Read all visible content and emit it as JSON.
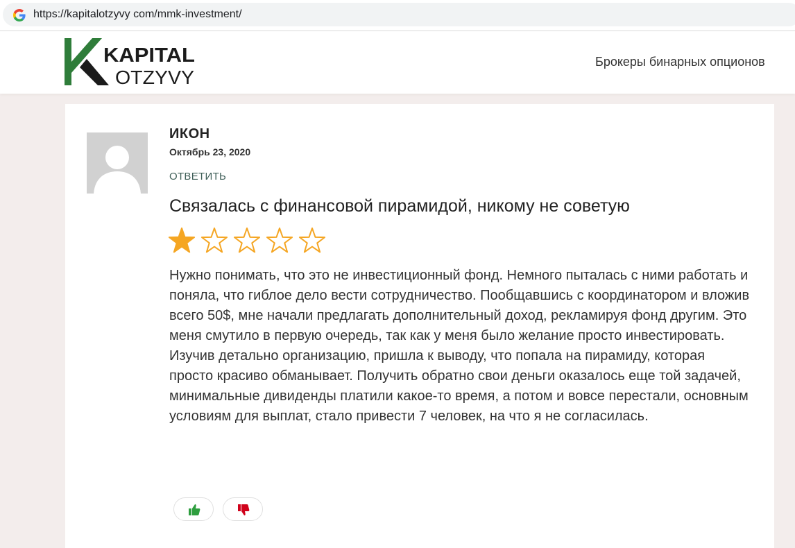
{
  "browser": {
    "url": "https://kapitalotzyvy com/mmk-investment/",
    "favicon": "google-g-icon"
  },
  "header": {
    "logo_line1": "KAPITAL",
    "logo_line2": "OTZYVY",
    "nav_item": "Брокеры бинарных опционов"
  },
  "review": {
    "author": "ИКОН",
    "date": "Октябрь 23, 2020",
    "reply_label": "ОТВЕТИТЬ",
    "title": "Связалась с финансовой пирамидой, никому не советую",
    "rating": 1,
    "rating_max": 5,
    "star_color": "#f5a623",
    "text": "Нужно понимать, что это не инвестиционный фонд. Немного пыталась с ними работать и поняла, что гиблое дело вести сотрудничество. Пообщавшись с координатором и вложив всего 50$, мне начали предлагать дополнительный доход, рекламируя фонд другим. Это меня смутило в первую очередь, так как у меня было желание просто инвестировать. Изучив детально организацию, пришла к выводу, что попала на пирамиду, которая просто красиво обманывает. Получить обратно свои деньги оказалось еще той задачей, минимальные дивиденды платили какое-то время, а потом и вовсе перестали, основным условиям для выплат, стало привести 7 человек, на что я не согласилась."
  },
  "votes": {
    "like_icon": "thumbs-up-icon",
    "like_color": "#2e9e3f",
    "dislike_icon": "thumbs-down-icon",
    "dislike_color": "#d0021b"
  },
  "colors": {
    "logo_green": "#2f7d3a",
    "logo_dark": "#1b1b1b",
    "reply_color": "#3f5f58"
  }
}
